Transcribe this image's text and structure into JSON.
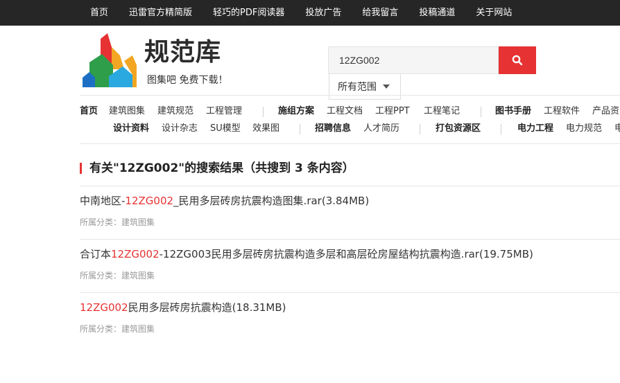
{
  "topnav": [
    "首页",
    "迅雷官方精简版",
    "轻巧的PDF阅读器",
    "投放广告",
    "给我留言",
    "投稿通道",
    "关于网站"
  ],
  "logo": {
    "title": "规范库",
    "slogan": "图集吧  免费下载！"
  },
  "search": {
    "value": "12ZG002",
    "scope": "所有范围"
  },
  "categories": {
    "row1": {
      "c1": "首页",
      "c2": "建筑图集",
      "c3": "建筑规范",
      "c4": "工程管理",
      "c5": "施组方案",
      "c6": "工程文档",
      "c7": "工程PPT",
      "c8": "工程笔记",
      "c9": "图书手册",
      "c10": "工程软件",
      "c11": "产品资"
    },
    "row2": {
      "c1": "设计资料",
      "c2": "设计杂志",
      "c3": "SU模型",
      "c4": "效果图",
      "c5": "招聘信息",
      "c6": "人才简历",
      "c7": "打包资源区",
      "c8": "电力工程",
      "c9": "电力规范",
      "c10": "电"
    }
  },
  "results": {
    "heading": "有关\"12ZG002\"的搜索结果（共搜到 3 条内容）",
    "items": [
      {
        "prefix": "中南地区-",
        "hl": "12ZG002",
        "suffix": "_民用多层砖房抗震构造图集.rar(3.84MB)",
        "cat": "所属分类：建筑图集"
      },
      {
        "prefix": "合订本",
        "hl": "12ZG002",
        "suffix": "-12ZG003民用多层砖房抗震构造多层和高层砼房屋结构抗震构造.rar(19.75MB)",
        "cat": "所属分类：建筑图集"
      },
      {
        "prefix": "",
        "hl": "12ZG002",
        "suffix": "民用多层砖房抗震构造(18.31MB)",
        "cat": "所属分类：建筑图集"
      }
    ]
  }
}
